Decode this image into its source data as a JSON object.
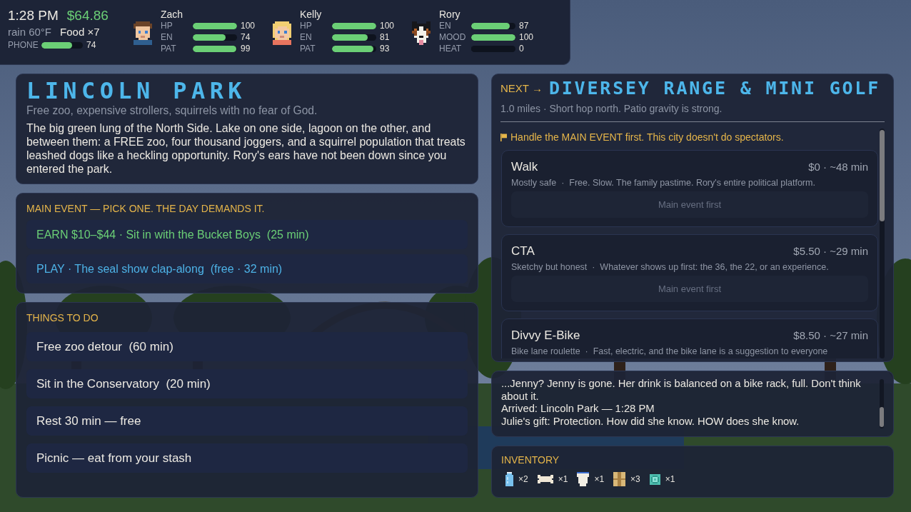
{
  "hud": {
    "time": "1:28 PM",
    "money": "$64.86",
    "weather": "rain 60°F",
    "food": "Food ×7",
    "phone": {
      "label": "PHONE",
      "level": 0.74,
      "value": "74"
    }
  },
  "party": [
    {
      "name": "Zach",
      "kind": "boy",
      "stats": [
        {
          "label": "HP",
          "level": 1,
          "value": "100"
        },
        {
          "label": "EN",
          "level": 0.74,
          "value": "74"
        },
        {
          "label": "PAT",
          "level": 0.99,
          "value": "99"
        }
      ]
    },
    {
      "name": "Kelly",
      "kind": "girl",
      "stats": [
        {
          "label": "HP",
          "level": 1,
          "value": "100"
        },
        {
          "label": "EN",
          "level": 0.81,
          "value": "81"
        },
        {
          "label": "PAT",
          "level": 0.93,
          "value": "93"
        }
      ]
    },
    {
      "name": "Rory",
      "kind": "dog",
      "stats": [
        {
          "label": "EN",
          "level": 0.87,
          "value": "87"
        },
        {
          "label": "MOOD",
          "level": 1,
          "value": "100"
        },
        {
          "label": "HEAT",
          "level": 0,
          "value": "0"
        }
      ]
    }
  ],
  "location": {
    "title": "LINCOLN PARK",
    "tagline": "Free zoo, expensive strollers, squirrels with no fear of God.",
    "description": "The big green lung of the North Side. Lake on one side, lagoon on the other, and between them: a FREE zoo, four thousand joggers, and a squirrel population that treats leashed dogs like a heckling opportunity. Rory's ears have not been down since you entered the park."
  },
  "main_event": {
    "heading": "MAIN EVENT — PICK ONE. THE DAY DEMANDS IT.",
    "options": [
      {
        "kind": "earn",
        "label": "EARN $10–$44 · Sit in with the Bucket Boys  (25 min)"
      },
      {
        "kind": "play",
        "label": "PLAY · The seal show clap-along  (free · 32 min)"
      }
    ]
  },
  "things_to_do": {
    "heading": "THINGS TO DO",
    "options": [
      "Free zoo detour  (60 min)",
      "Sit in the Conservatory  (20 min)",
      "Rest 30 min — free",
      "Picnic — eat from your stash"
    ]
  },
  "next_stop": {
    "prefix": "NEXT →",
    "title": "DIVERSEY RANGE & MINI GOLF",
    "summary": "1.0 miles · Short hop north. Patio gravity is strong.",
    "notice": "Handle the MAIN EVENT first. This city doesn't do spectators.",
    "routes": [
      {
        "name": "Walk",
        "cost": "$0 · ~48 min",
        "detail": "Mostly safe  ·  Free. Slow. The family pastime. Rory's entire political platform.",
        "button": {
          "label": "Main event first",
          "disabled": true
        }
      },
      {
        "name": "CTA",
        "cost": "$5.50 · ~29 min",
        "detail": "Sketchy but honest  ·  Whatever shows up first: the 36, the 22, or an experience.",
        "button": {
          "label": "Main event first",
          "disabled": true
        }
      },
      {
        "name": "Divvy E-Bike",
        "cost": "$8.50 · ~27 min",
        "detail": "Bike lane roulette  ·  Fast, electric, and the bike lane is a suggestion to everyone"
      }
    ]
  },
  "log": {
    "lines": [
      "...Jenny? Jenny is gone. Her drink is balanced on a bike rack, full. Don't think about it.",
      "Arrived: Lincoln Park — 1:28 PM",
      "Julie's gift: Protection. How did she know. HOW does she know."
    ]
  },
  "inventory": {
    "heading": "INVENTORY",
    "items": [
      {
        "kind": "bottle",
        "count": "×2"
      },
      {
        "kind": "bone",
        "count": "×1"
      },
      {
        "kind": "cup",
        "count": "×1"
      },
      {
        "kind": "box",
        "count": "×3"
      },
      {
        "kind": "tile",
        "count": "×1"
      }
    ]
  }
}
